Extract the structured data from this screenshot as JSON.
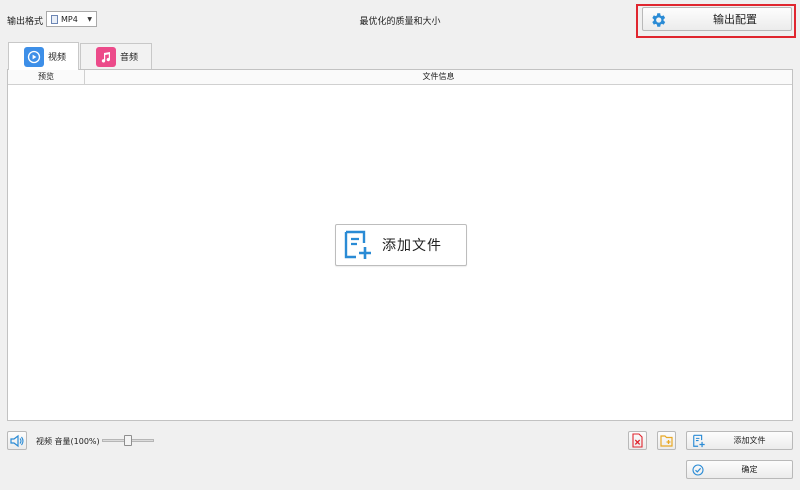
{
  "top_bar": {
    "format_label": "输出格式",
    "format_value": "MP4",
    "center_title": "最优化的质量和大小",
    "export_button_label": "输出配置"
  },
  "tabs": [
    {
      "label": "视频",
      "icon": "play-circle-icon",
      "active": true,
      "color": "#3d8fe8"
    },
    {
      "label": "音频",
      "icon": "music-note-icon",
      "active": false,
      "color": "#ec4b8a"
    }
  ],
  "table": {
    "columns": [
      "预览",
      "文件信息"
    ],
    "empty_action_label": "添加文件"
  },
  "bottom_bar": {
    "volume_label": "视频 音量(100%)",
    "volume_level": 0.5,
    "add_file_label": "添加文件",
    "ok_label": "确定"
  },
  "colors": {
    "accent_blue": "#2a8bd5",
    "highlight_red": "#e0262f",
    "folder_yellow": "#e8a825"
  }
}
